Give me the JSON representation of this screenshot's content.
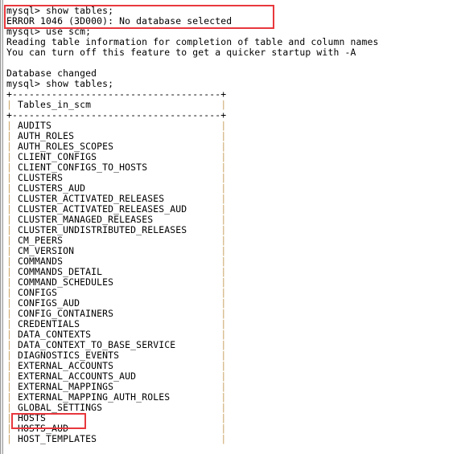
{
  "terminal": {
    "prompt": "mysql>",
    "lines_before_table": [
      "mysql> show tables;",
      "ERROR 1046 (3D000): No database selected",
      "mysql> use scm;",
      "Reading table information for completion of table and column names",
      "You can turn off this feature to get a quicker startup with -A",
      "",
      "Database changed",
      "mysql> show tables;"
    ],
    "table": {
      "border_line": "+-------------------------------------+",
      "header": "Tables_in_scm",
      "rows": [
        "AUDITS",
        "AUTH_ROLES",
        "AUTH_ROLES_SCOPES",
        "CLIENT_CONFIGS",
        "CLIENT_CONFIGS_TO_HOSTS",
        "CLUSTERS",
        "CLUSTERS_AUD",
        "CLUSTER_ACTIVATED_RELEASES",
        "CLUSTER_ACTIVATED_RELEASES_AUD",
        "CLUSTER_MANAGED_RELEASES",
        "CLUSTER_UNDISTRIBUTED_RELEASES",
        "CM_PEERS",
        "CM_VERSION",
        "COMMANDS",
        "COMMANDS_DETAIL",
        "COMMAND_SCHEDULES",
        "CONFIGS",
        "CONFIGS_AUD",
        "CONFIG_CONTAINERS",
        "CREDENTIALS",
        "DATA_CONTEXTS",
        "DATA_CONTEXT_TO_BASE_SERVICE",
        "DIAGNOSTICS_EVENTS",
        "EXTERNAL_ACCOUNTS",
        "EXTERNAL_ACCOUNTS_AUD",
        "EXTERNAL_MAPPINGS",
        "EXTERNAL_MAPPING_AUTH_ROLES",
        "GLOBAL_SETTINGS",
        "HOSTS",
        "HOSTS_AUD",
        "HOST_TEMPLATES"
      ]
    },
    "highlights": [
      {
        "label": "error-no-database-selected",
        "color": "#e8383d"
      },
      {
        "label": "hosts-table",
        "color": "#e8383d"
      }
    ]
  }
}
